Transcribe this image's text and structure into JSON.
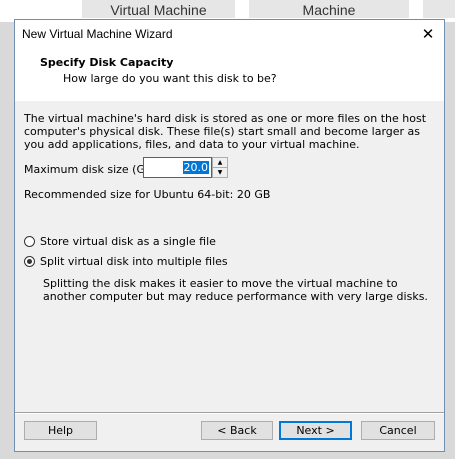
{
  "background_tabs": [
    "Virtual Machine",
    "Machine"
  ],
  "window": {
    "title": "New Virtual Machine Wizard",
    "close_glyph": "✕"
  },
  "header": {
    "title": "Specify Disk Capacity",
    "subtitle": "How large do you want this disk to be?"
  },
  "description": "The virtual machine's hard disk is stored as one or more files on the host computer's physical disk. These file(s) start small and become larger as you add applications, files, and data to your virtual machine.",
  "disk_size": {
    "label": "Maximum disk size (GB):",
    "value": "20.0"
  },
  "recommended": "Recommended size for Ubuntu 64-bit: 20 GB",
  "options": {
    "single_file": {
      "label": "Store virtual disk as a single file",
      "selected": false
    },
    "multiple_files": {
      "label": "Split virtual disk into multiple files",
      "selected": true
    },
    "split_description": "Splitting the disk makes it easier to move the virtual machine to another computer but may reduce performance with very large disks."
  },
  "buttons": {
    "help": "Help",
    "back": "< Back",
    "next": "Next >",
    "cancel": "Cancel"
  },
  "colors": {
    "accent": "#0078d7",
    "dialog_bg": "#f0f0f0"
  }
}
